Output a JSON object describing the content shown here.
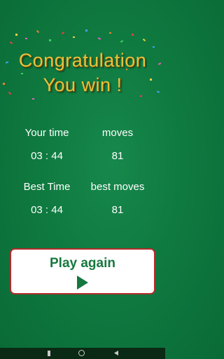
{
  "title": {
    "line1": "Congratulation",
    "line2": "You win !"
  },
  "stats": {
    "your_time_label": "Your time",
    "moves_label": "moves",
    "your_time_value": "03 : 44",
    "moves_value": "81",
    "best_time_label": "Best Time",
    "best_moves_label": "best moves",
    "best_time_value": "03 : 44",
    "best_moves_value": "81"
  },
  "play_again": {
    "label": "Play again",
    "icon": "play-icon"
  },
  "nav": {
    "back_icon": "back-icon",
    "home_icon": "home-icon",
    "recent_icon": "recent-apps-icon"
  },
  "colors": {
    "background": "#0f7a40",
    "title_gold": "#e8c23d",
    "button_text": "#16783e",
    "button_border": "#b32c2c",
    "play_icon": "#16783e"
  }
}
